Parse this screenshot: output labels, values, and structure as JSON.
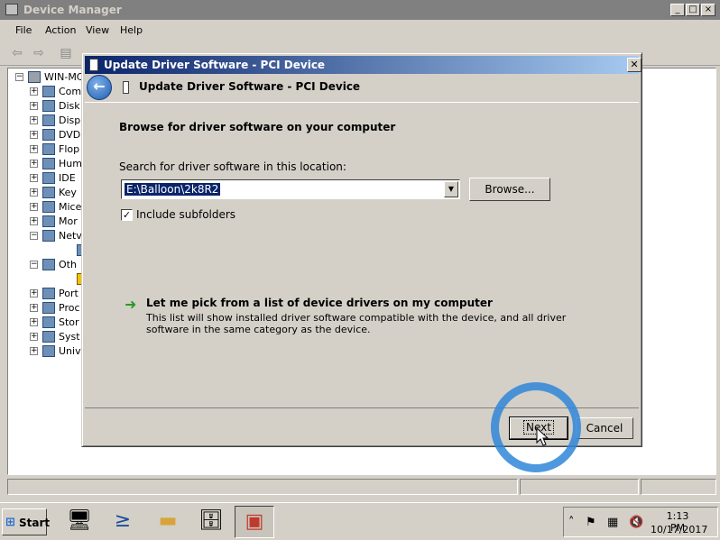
{
  "device_manager": {
    "title": "Device Manager",
    "menu": [
      "File",
      "Action",
      "View",
      "Help"
    ],
    "tree": {
      "root": "WIN-MC",
      "items": [
        {
          "label": "Com",
          "icon": "computer-icon",
          "expander": "+"
        },
        {
          "label": "Disk",
          "icon": "disk-drive-icon",
          "expander": "+"
        },
        {
          "label": "Disp",
          "icon": "display-adapter-icon",
          "expander": "+"
        },
        {
          "label": "DVD",
          "icon": "dvd-drive-icon",
          "expander": "+"
        },
        {
          "label": "Flop",
          "icon": "floppy-icon",
          "expander": "+"
        },
        {
          "label": "Hum",
          "icon": "hid-icon",
          "expander": "+"
        },
        {
          "label": "IDE",
          "icon": "ide-controller-icon",
          "expander": "+"
        },
        {
          "label": "Key",
          "icon": "keyboard-icon",
          "expander": "+"
        },
        {
          "label": "Mice",
          "icon": "mouse-icon",
          "expander": "+"
        },
        {
          "label": "Mor",
          "icon": "monitor-icon",
          "expander": "+"
        },
        {
          "label": "Netv",
          "icon": "network-adapter-icon",
          "expander": "-"
        },
        {
          "label": "",
          "icon": "network-device-icon",
          "expander": "",
          "child": true
        },
        {
          "label": "Oth",
          "icon": "other-devices-icon",
          "expander": "-"
        },
        {
          "label": "",
          "icon": "warning-device-icon",
          "expander": "",
          "child": true
        },
        {
          "label": "Port",
          "icon": "port-icon",
          "expander": "+"
        },
        {
          "label": "Proc",
          "icon": "processor-icon",
          "expander": "+"
        },
        {
          "label": "Stor",
          "icon": "storage-icon",
          "expander": "+"
        },
        {
          "label": "Syst",
          "icon": "system-devices-icon",
          "expander": "+"
        },
        {
          "label": "Univ",
          "icon": "usb-icon",
          "expander": "+"
        }
      ]
    }
  },
  "dialog": {
    "window_title": "Update Driver Software - PCI Device",
    "header_title": "Update Driver Software - PCI Device",
    "heading": "Browse for driver software on your computer",
    "location_label": "Search for driver software in this location:",
    "location_value": "E:\\Balloon\\2k8R2",
    "browse_label": "Browse...",
    "include_subfolders_label": "Include subfolders",
    "include_subfolders_checked": true,
    "pick_title": "Let me pick from a list of device drivers on my computer",
    "pick_description": "This list will show installed driver software compatible with the device, and all driver software in the same category as the device.",
    "next_label": "Next",
    "cancel_label": "Cancel"
  },
  "taskbar": {
    "start_label": "Start",
    "clock_time": "1:13 PM",
    "clock_date": "10/17/2017",
    "apps": [
      "server-manager-icon",
      "powershell-icon",
      "explorer-folder-icon",
      "server-tools-icon",
      "toolbox-icon"
    ]
  },
  "colors": {
    "title_active_start": "#0a246a",
    "title_active_end": "#a6caf0",
    "highlight_ring": "#2f86d8",
    "face": "#d4d0c8"
  }
}
